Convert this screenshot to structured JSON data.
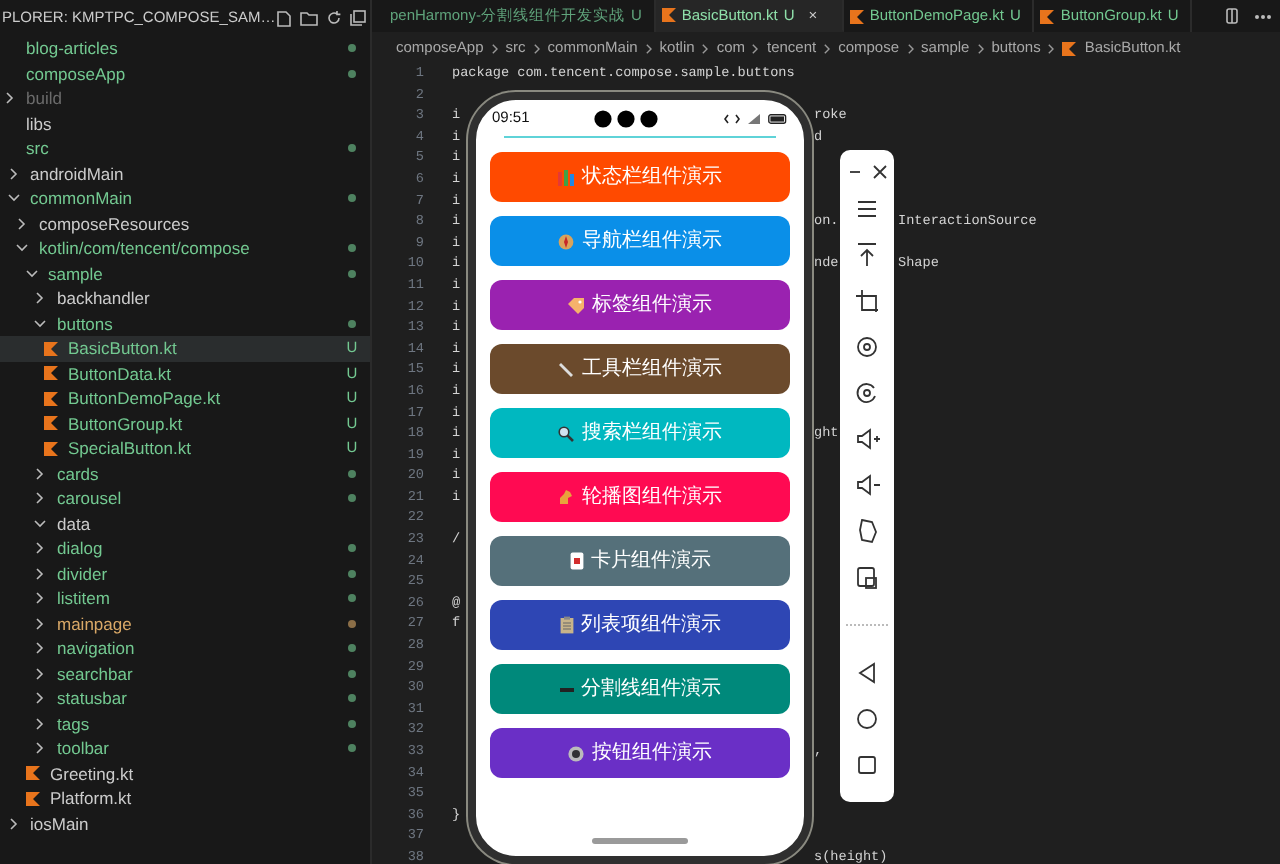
{
  "explorer": {
    "title": "PLORER: KMPTPC_COMPOSE_SAM…",
    "tree": [
      {
        "label": "blog-articles",
        "kind": "folder",
        "color": "#73c991",
        "dot": true,
        "selected": false
      },
      {
        "label": "composeApp",
        "kind": "folder",
        "color": "#73c991",
        "dot": true,
        "selected": false,
        "children": [
          {
            "label": "build",
            "kind": "folder",
            "color": "#6b6b6b",
            "dot": false,
            "expanded": false,
            "selected": false
          },
          {
            "label": "libs",
            "kind": "folder",
            "color": "#cccccc",
            "dot": false,
            "selected": false
          },
          {
            "label": "src",
            "kind": "folder",
            "color": "#73c991",
            "dot": true,
            "selected": false,
            "children": [
              {
                "label": "androidMain",
                "kind": "folder",
                "color": "#cccccc",
                "dot": false,
                "expanded": false,
                "selected": false
              },
              {
                "label": "commonMain",
                "kind": "folder",
                "color": "#73c991",
                "dot": true,
                "expanded": true,
                "selected": false,
                "children": [
                  {
                    "label": "composeResources",
                    "kind": "folder",
                    "color": "#cccccc",
                    "dot": false,
                    "expanded": false,
                    "selected": false
                  },
                  {
                    "label": "kotlin/com/tencent/compose",
                    "kind": "folder",
                    "color": "#73c991",
                    "dot": true,
                    "expanded": true,
                    "selected": false,
                    "children": [
                      {
                        "label": "sample",
                        "kind": "folder",
                        "color": "#73c991",
                        "dot": true,
                        "expanded": true,
                        "selected": false,
                        "children": [
                          {
                            "label": "backhandler",
                            "kind": "folder",
                            "color": "#cccccc",
                            "dot": false,
                            "expanded": false,
                            "selected": false
                          },
                          {
                            "label": "buttons",
                            "kind": "folder",
                            "color": "#73c991",
                            "dot": true,
                            "expanded": true,
                            "selected": false,
                            "children": [
                              {
                                "label": "BasicButton.kt",
                                "kind": "file",
                                "color": "#73c991",
                                "badge": "U",
                                "selected": true
                              },
                              {
                                "label": "ButtonData.kt",
                                "kind": "file",
                                "color": "#73c991",
                                "badge": "U",
                                "selected": false
                              },
                              {
                                "label": "ButtonDemoPage.kt",
                                "kind": "file",
                                "color": "#73c991",
                                "badge": "U",
                                "selected": false
                              },
                              {
                                "label": "ButtonGroup.kt",
                                "kind": "file",
                                "color": "#73c991",
                                "badge": "U",
                                "selected": false
                              },
                              {
                                "label": "SpecialButton.kt",
                                "kind": "file",
                                "color": "#73c991",
                                "badge": "U",
                                "selected": false
                              }
                            ]
                          },
                          {
                            "label": "cards",
                            "kind": "folder",
                            "color": "#73c991",
                            "dot": true,
                            "expanded": false,
                            "selected": false
                          },
                          {
                            "label": "carousel",
                            "kind": "folder",
                            "color": "#73c991",
                            "dot": true,
                            "expanded": false,
                            "selected": false
                          },
                          {
                            "label": "data",
                            "kind": "folder",
                            "color": "#cccccc",
                            "dot": false,
                            "expanded": true,
                            "selected": false
                          },
                          {
                            "label": "dialog",
                            "kind": "folder",
                            "color": "#73c991",
                            "dot": true,
                            "expanded": false,
                            "selected": false
                          },
                          {
                            "label": "divider",
                            "kind": "folder",
                            "color": "#73c991",
                            "dot": true,
                            "expanded": false,
                            "selected": false
                          },
                          {
                            "label": "listitem",
                            "kind": "folder",
                            "color": "#73c991",
                            "dot": true,
                            "expanded": false,
                            "selected": false
                          },
                          {
                            "label": "mainpage",
                            "kind": "folder",
                            "color": "#d9a867",
                            "dot": true,
                            "expanded": false,
                            "selected": false
                          },
                          {
                            "label": "navigation",
                            "kind": "folder",
                            "color": "#73c991",
                            "dot": true,
                            "expanded": false,
                            "selected": false
                          },
                          {
                            "label": "searchbar",
                            "kind": "folder",
                            "color": "#73c991",
                            "dot": true,
                            "expanded": false,
                            "selected": false
                          },
                          {
                            "label": "statusbar",
                            "kind": "folder",
                            "color": "#73c991",
                            "dot": true,
                            "expanded": false,
                            "selected": false
                          },
                          {
                            "label": "tags",
                            "kind": "folder",
                            "color": "#73c991",
                            "dot": true,
                            "expanded": false,
                            "selected": false
                          },
                          {
                            "label": "toolbar",
                            "kind": "folder",
                            "color": "#73c991",
                            "dot": true,
                            "expanded": false,
                            "selected": false
                          }
                        ]
                      },
                      {
                        "label": "Greeting.kt",
                        "kind": "file",
                        "color": "#cccccc",
                        "selected": false
                      },
                      {
                        "label": "Platform.kt",
                        "kind": "file",
                        "color": "#cccccc",
                        "selected": false
                      }
                    ]
                  }
                ]
              },
              {
                "label": "iosMain",
                "kind": "folder",
                "color": "#cccccc",
                "dot": false,
                "expanded": false,
                "selected": false
              }
            ]
          }
        ]
      }
    ]
  },
  "tabs": [
    {
      "label": "penHarmony-分割线组件开发实战",
      "badge": "U",
      "file_icon": false,
      "selected": false
    },
    {
      "label": "BasicButton.kt",
      "badge": "U",
      "file_icon": true,
      "selected": true,
      "close": "×"
    },
    {
      "label": "ButtonDemoPage.kt",
      "badge": "U",
      "file_icon": true,
      "selected": false
    },
    {
      "label": "ButtonGroup.kt",
      "badge": "U",
      "file_icon": true,
      "selected": false
    }
  ],
  "breadcrumb": [
    "composeApp",
    "src",
    "commonMain",
    "kotlin",
    "com",
    "tencent",
    "compose",
    "sample",
    "buttons",
    "BasicButton.kt"
  ],
  "code_lines": [
    {
      "number": "1",
      "text": "package com.tencent.compose.sample.buttons"
    },
    {
      "number": "2"
    },
    {
      "number": "3",
      "text": "i",
      "right": "roke"
    },
    {
      "number": "4",
      "text": "i",
      "right": "d"
    },
    {
      "number": "5",
      "text": "i"
    },
    {
      "number": "6",
      "text": "i"
    },
    {
      "number": "7",
      "text": "i"
    },
    {
      "number": "8",
      "text": "i",
      "right": "on.",
      "far": "InteractionSource"
    },
    {
      "number": "9",
      "text": "i"
    },
    {
      "number": "10",
      "text": "i",
      "right": "nde",
      "far": "Shape"
    },
    {
      "number": "11",
      "text": "i"
    },
    {
      "number": "12",
      "text": "i"
    },
    {
      "number": "13",
      "text": "i"
    },
    {
      "number": "14",
      "text": "i"
    },
    {
      "number": "15",
      "text": "i"
    },
    {
      "number": "16",
      "text": "i"
    },
    {
      "number": "17",
      "text": "i"
    },
    {
      "number": "18",
      "text": "i",
      "right": "ght"
    },
    {
      "number": "19",
      "text": "i"
    },
    {
      "number": "20",
      "text": "i"
    },
    {
      "number": "21",
      "text": "i"
    },
    {
      "number": "22"
    },
    {
      "number": "23",
      "text": "/"
    },
    {
      "number": "24"
    },
    {
      "number": "25"
    },
    {
      "number": "26",
      "text": "@"
    },
    {
      "number": "27",
      "text": "f"
    },
    {
      "number": "28"
    },
    {
      "number": "29"
    },
    {
      "number": "30"
    },
    {
      "number": "31"
    },
    {
      "number": "32"
    },
    {
      "number": "33",
      "right": ","
    },
    {
      "number": "34"
    },
    {
      "number": "35"
    },
    {
      "number": "36",
      "text": "}"
    },
    {
      "number": "37"
    },
    {
      "number": "38",
      "right": "s(height)"
    }
  ],
  "phone": {
    "time": "09:51",
    "buttons": [
      {
        "label": "状态栏组件演示",
        "color": "#ff4a00"
      },
      {
        "label": "导航栏组件演示",
        "color": "#0a8fe8"
      },
      {
        "label": "标签组件演示",
        "color": "#9a22b0"
      },
      {
        "label": "工具栏组件演示",
        "color": "#6b4a2c"
      },
      {
        "label": "搜索栏组件演示",
        "color": "#00b8c0"
      },
      {
        "label": "轮播图组件演示",
        "color": "#ff0a52"
      },
      {
        "label": "卡片组件演示",
        "color": "#55707a"
      },
      {
        "label": "列表项组件演示",
        "color": "#2e46b4"
      },
      {
        "label": "分割线组件演示",
        "color": "#00897b"
      },
      {
        "label": "按钮组件演示",
        "color": "#6a2fc6"
      }
    ]
  }
}
